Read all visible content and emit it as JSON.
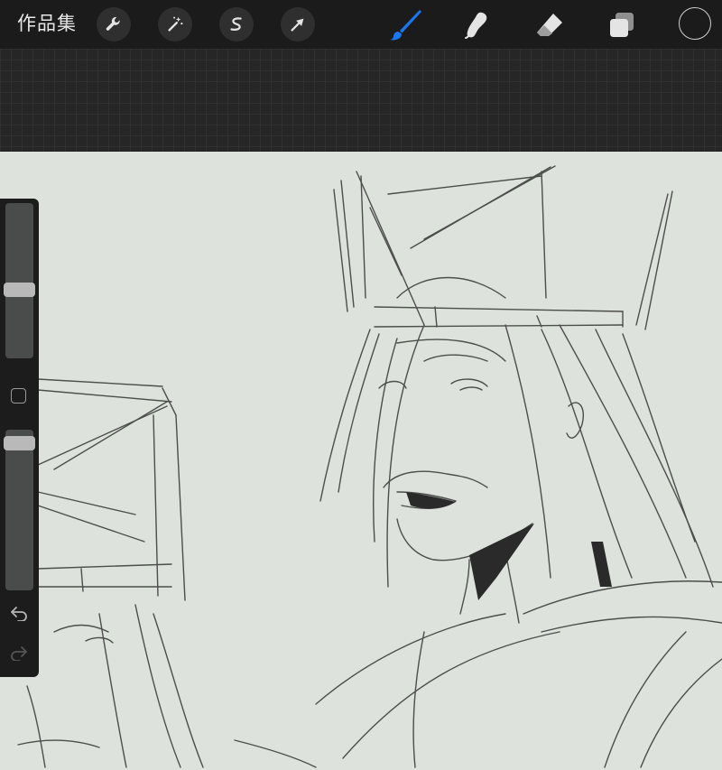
{
  "toolbar": {
    "gallery_label": "作品集",
    "left_tools": [
      "wrench-icon",
      "magic-wand-icon",
      "selection-icon",
      "transform-arrow-icon"
    ],
    "right_tools": [
      "brush-icon",
      "smudge-icon",
      "eraser-icon",
      "layers-icon"
    ],
    "active_tool": "brush",
    "active_color": "#1877f2",
    "current_color": "#1b1b1b"
  },
  "sidebar": {
    "brush_size_level": 0.55,
    "opacity_level": 0.95
  }
}
